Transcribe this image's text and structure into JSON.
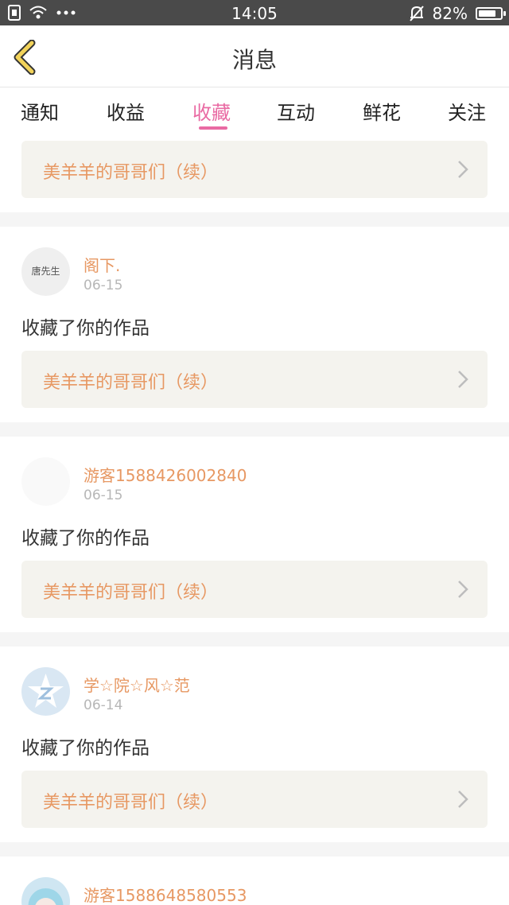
{
  "status_bar": {
    "time": "14:05",
    "battery": "82%",
    "battery_level": 0.82,
    "icons": [
      "sim-icon",
      "wifi-icon",
      "more-dots-icon",
      "mute-bell-icon",
      "battery-icon"
    ]
  },
  "header": {
    "title": "消息",
    "back_icon": "chevron-left-icon"
  },
  "tabs": {
    "items": [
      "通知",
      "收益",
      "收藏",
      "互动",
      "鲜花",
      "关注"
    ],
    "active": "收藏"
  },
  "feed": {
    "top_work": "美羊羊的哥哥们（续）",
    "items": [
      {
        "user": "阁下.",
        "date": "06-15",
        "avatar_text": "唐先生",
        "action": "收藏了你的作品",
        "work": "美羊羊的哥哥们（续）"
      },
      {
        "user": "游客1588426002840",
        "date": "06-15",
        "action": "收藏了你的作品",
        "work": "美羊羊的哥哥们（续）"
      },
      {
        "user": "学☆院☆风☆范",
        "date": "06-14",
        "action": "收藏了你的作品",
        "work": "美羊羊的哥哥们（续）"
      },
      {
        "user": "游客1588648580553"
      }
    ]
  },
  "colors": {
    "accent_pink": "#e96aa3",
    "orange_text": "#e79863",
    "work_box_bg": "#f4f3ee",
    "status_bar_bg": "#4a4a4a"
  }
}
